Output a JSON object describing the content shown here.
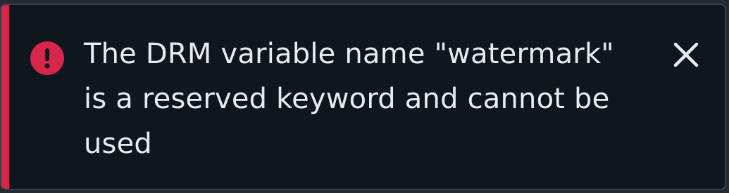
{
  "toast": {
    "severity": "error",
    "message": "The DRM variable name \"watermark\" is a reserved keyword and cannot be used",
    "accent_color": "#d6264a",
    "background_color": "#0f161d",
    "text_color": "#e9ecef",
    "icon": "alert-circle-icon",
    "close_icon": "close-icon"
  }
}
